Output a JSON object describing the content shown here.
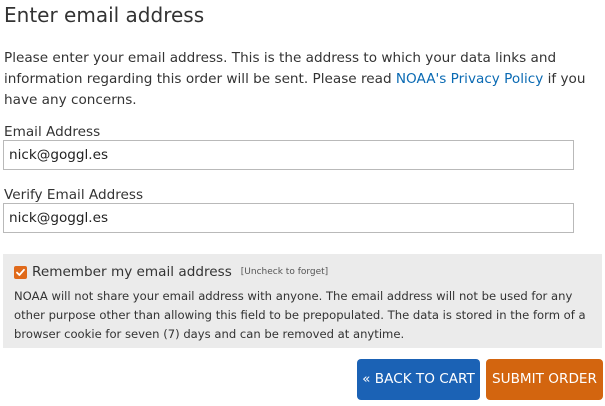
{
  "page": {
    "title": "Enter email address"
  },
  "intro": {
    "text_before": "Please enter your email address. This is the address to which your data links and information regarding this order will be sent. Please read ",
    "link_text": "NOAA's Privacy Policy",
    "text_after": " if you have any concerns."
  },
  "email": {
    "label": "Email Address",
    "value": "nick@goggl.es"
  },
  "verify_email": {
    "label": "Verify Email Address",
    "value": "nick@goggl.es"
  },
  "remember": {
    "checked": true,
    "label": "Remember my email address",
    "hint": "[Uncheck to forget]",
    "note": "NOAA will not share your email address with anyone. The email address will not be used for any other purpose other than allowing this field to be prepopulated. The data is stored in the form of a browser cookie for seven (7) days and can be removed at anytime."
  },
  "actions": {
    "back_label": "« BACK TO CART",
    "submit_label": "SUBMIT ORDER"
  },
  "colors": {
    "link": "#0a6ab3",
    "checkbox": "#e06a1b",
    "back_button": "#1b62b5",
    "submit_button": "#d3650f",
    "panel_background": "#ebebeb"
  },
  "icons": {
    "checkbox_mark": "check-icon"
  }
}
